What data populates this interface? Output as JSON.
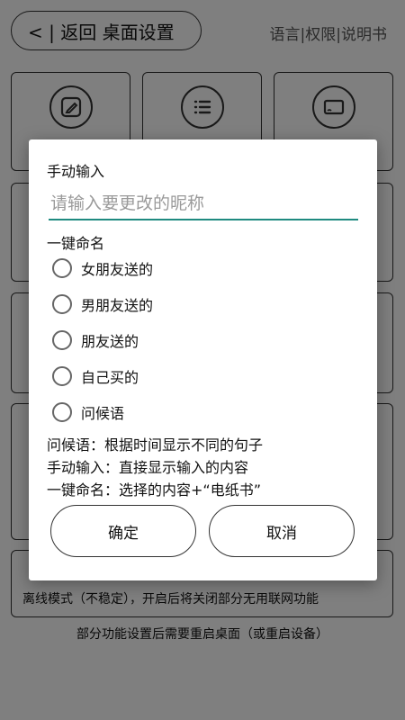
{
  "header": {
    "back_label": "< | 返回  桌面设置",
    "links": "语言|权限|说明书"
  },
  "background": {
    "offline_label": "离线模式（不稳定），开启后将关闭部分无用联网功能",
    "footer_note": "部分功能设置后需要重启桌面（或重启设备）"
  },
  "dialog": {
    "title": "手动输入",
    "input_placeholder": "请输入要更改的昵称",
    "section_label": "一键命名",
    "options": [
      "女朋友送的",
      "男朋友送的",
      "朋友送的",
      "自己买的",
      "问候语"
    ],
    "desc_lines": [
      "问候语：根据时间显示不同的句子",
      "手动输入：直接显示输入的内容",
      "一键命名：选择的内容+“电纸书”"
    ],
    "confirm_label": "确定",
    "cancel_label": "取消"
  },
  "colors": {
    "accent": "#1f8a80",
    "overlay": "rgba(0,0,0,0.5)"
  },
  "icons": [
    "edit-icon",
    "list-icon",
    "cast-icon"
  ]
}
